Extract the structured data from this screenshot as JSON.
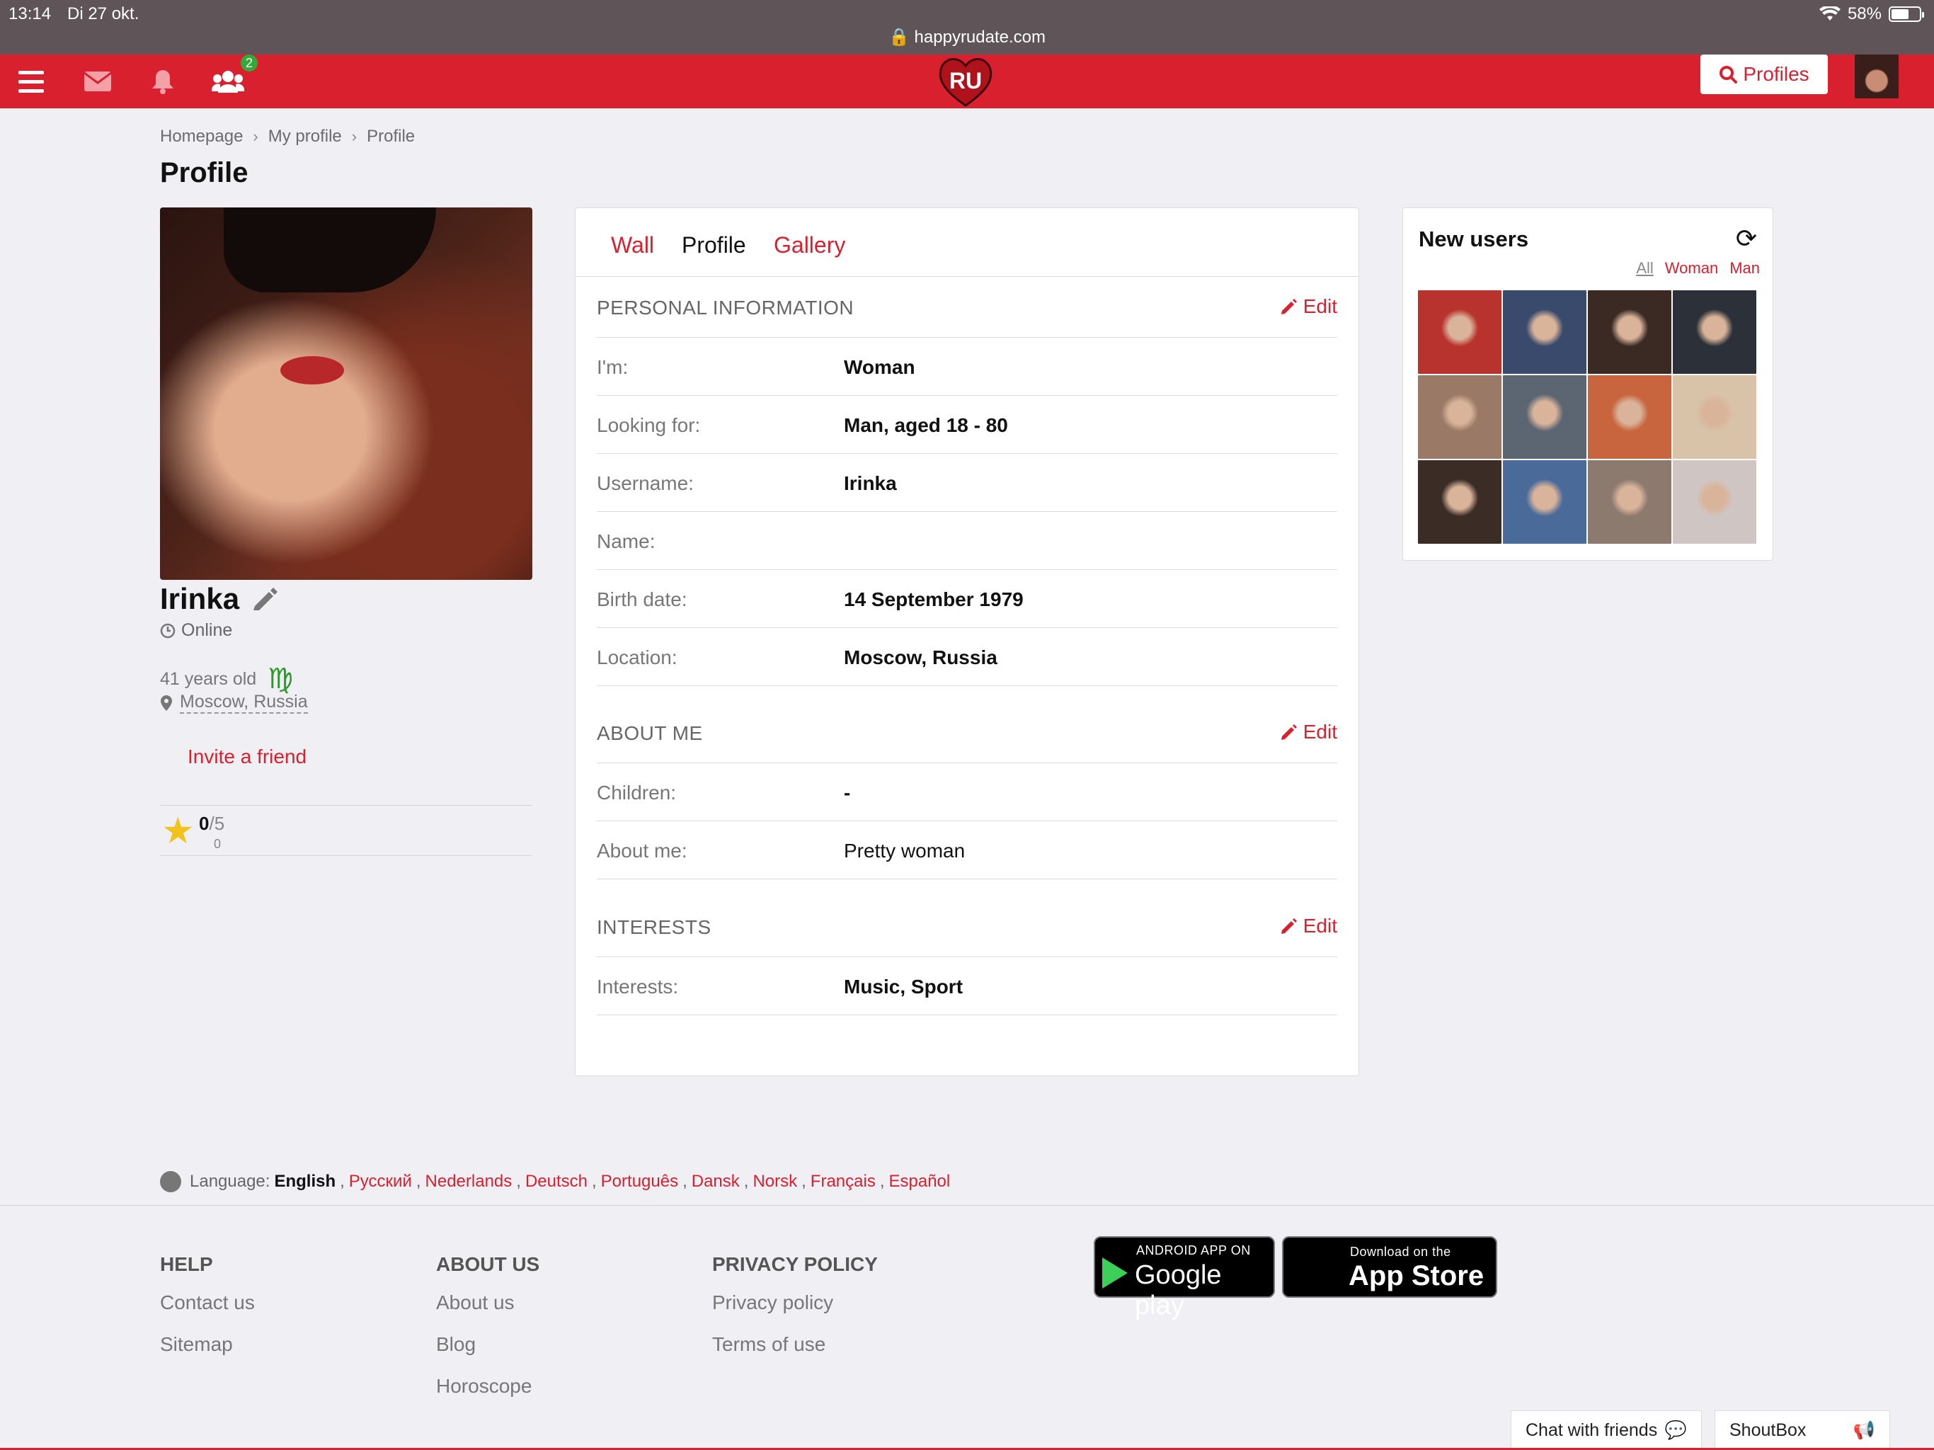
{
  "status": {
    "time": "13:14",
    "date": "Di 27 okt.",
    "battery": "58%",
    "url": "happyrudate.com"
  },
  "header": {
    "badge_count": "2",
    "logo_text": "RU",
    "profiles_label": "Profiles"
  },
  "breadcrumb": [
    "Homepage",
    "My profile",
    "Profile"
  ],
  "page_title": "Profile",
  "user": {
    "name": "Irinka",
    "status": "Online",
    "age": "41 years old",
    "zodiac_symbol": "♍",
    "location": "Moscow, Russia",
    "invite": "Invite a friend",
    "rating_score": "0",
    "rating_max": "/5",
    "rating_count": "0"
  },
  "tabs": [
    "Wall",
    "Profile",
    "Gallery"
  ],
  "sections": {
    "personal": {
      "label": "PERSONAL INFORMATION",
      "edit": "Edit",
      "rows": [
        {
          "key": "I'm:",
          "value": "Woman"
        },
        {
          "key": "Looking for:",
          "value": "Man, aged 18 - 80"
        },
        {
          "key": "Username:",
          "value": "Irinka"
        },
        {
          "key": "Name:",
          "value": ""
        },
        {
          "key": "Birth date:",
          "value": "14 September 1979"
        },
        {
          "key": "Location:",
          "value": "Moscow, Russia"
        }
      ]
    },
    "about": {
      "label": "ABOUT ME",
      "edit": "Edit",
      "rows": [
        {
          "key": "Children:",
          "value": "-"
        },
        {
          "key": "About me:",
          "value": "Pretty woman"
        }
      ]
    },
    "interests": {
      "label": "INTERESTS",
      "edit": "Edit",
      "rows": [
        {
          "key": "Interests:",
          "value": "Music, Sport"
        }
      ]
    }
  },
  "new_users": {
    "title": "New users",
    "filters": [
      "All",
      "Woman",
      "Man"
    ],
    "thumb_colors": [
      "#b8322e",
      "#3a4a6c",
      "#3b2a24",
      "#2c3038",
      "#9a7a66",
      "#5c6672",
      "#c8653e",
      "#d8c2a8",
      "#3b2c26",
      "#4a6a9a",
      "#8c7a6e",
      "#cfc6c4"
    ]
  },
  "language": {
    "label": "Language:",
    "current": "English",
    "others": [
      "Русский",
      "Nederlands",
      "Deutsch",
      "Português",
      "Dansk",
      "Norsk",
      "Français",
      "Español"
    ]
  },
  "footer": {
    "help": {
      "title": "HELP",
      "links": [
        "Contact us",
        "Sitemap"
      ]
    },
    "about": {
      "title": "ABOUT US",
      "links": [
        "About us",
        "Blog",
        "Horoscope"
      ]
    },
    "privacy": {
      "title": "PRIVACY POLICY",
      "links": [
        "Privacy policy",
        "Terms of use"
      ]
    },
    "google": {
      "small": "ANDROID APP ON",
      "big": "Google play"
    },
    "apple": {
      "small": "Download on the",
      "big": "App Store"
    }
  },
  "chat": {
    "friends": "Chat with friends",
    "shoutbox": "ShoutBox"
  },
  "colors": {
    "brand": "#d9202e",
    "online_badge": "#35a83a",
    "zodiac": "#2b9a2b",
    "star": "#f2c31b"
  }
}
